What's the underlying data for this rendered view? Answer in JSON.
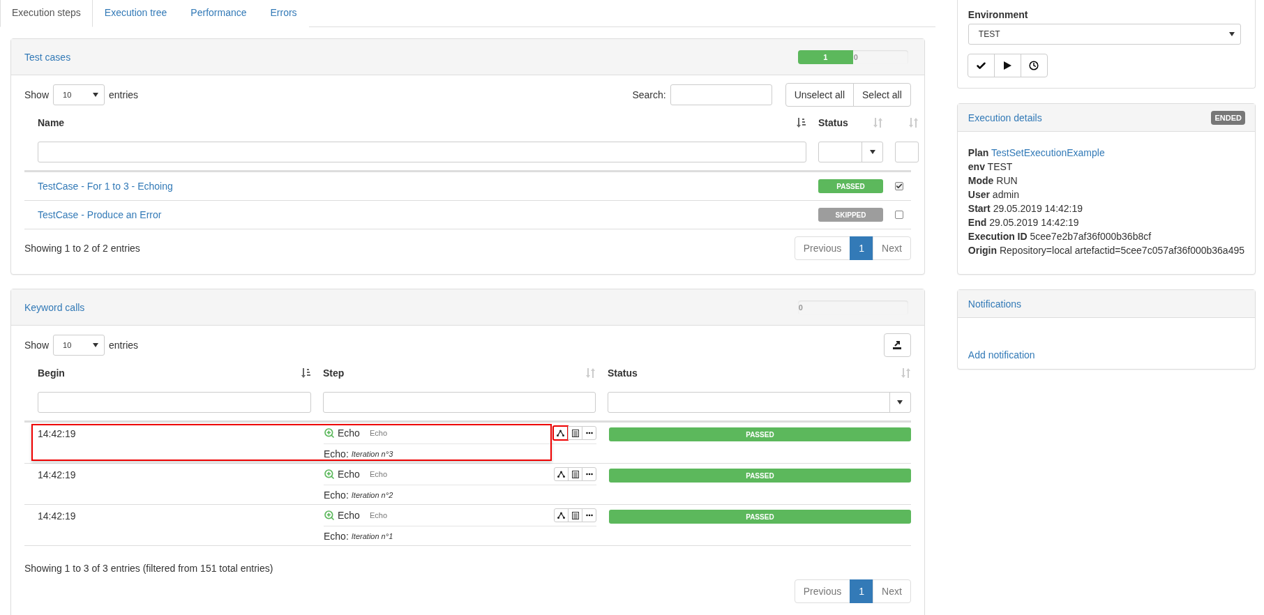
{
  "tabs": [
    {
      "label": "Execution steps",
      "selected": true
    },
    {
      "label": "Execution tree",
      "selected": false
    },
    {
      "label": "Performance",
      "selected": false
    },
    {
      "label": "Errors",
      "selected": false
    }
  ],
  "test_cases": {
    "title": "Test cases",
    "progress": {
      "level": 0.5,
      "fill_label": "1",
      "rest_label": "0"
    },
    "length": {
      "before": "Show",
      "value": "10",
      "after": "entries"
    },
    "search": {
      "label": "Search:"
    },
    "buttons": [
      "Unselect all",
      "Select all"
    ],
    "columns": [
      {
        "label": "Name",
        "sorted": true
      },
      {
        "label": "Status",
        "sorted": false
      },
      {
        "sorted": false
      }
    ],
    "rows": [
      {
        "name": "TestCase - For 1 to 3 - Echoing",
        "status": "PASSED",
        "kind": "passed",
        "checked": true
      },
      {
        "name": "TestCase - Produce an Error",
        "status": "SKIPPED",
        "kind": "skipped",
        "checked": false
      }
    ],
    "info": "Showing 1 to 2 of 2 entries",
    "pagination": {
      "previous": "Previous",
      "pages": [
        {
          "label": "1",
          "selected": true
        }
      ],
      "next": "Next"
    }
  },
  "keyword_calls": {
    "title": "Keyword calls",
    "progress": {
      "level": 0,
      "rest_label": "0"
    },
    "length": {
      "before": "Show",
      "value": "10",
      "after": "entries"
    },
    "columns": [
      {
        "label": "Begin",
        "sorted": true
      },
      {
        "label": "Step",
        "sorted": false
      },
      {
        "label": "Status",
        "sorted": false
      }
    ],
    "rows": [
      {
        "begin": "14:42:19",
        "step": "Echo",
        "step_type": "Echo",
        "detail_label": "Echo:",
        "detail_value": "Iteration n°3",
        "status": "PASSED",
        "kind": "passed",
        "highlighted": true,
        "tree_button_highlighted": true
      },
      {
        "begin": "14:42:19",
        "step": "Echo",
        "step_type": "Echo",
        "detail_label": "Echo:",
        "detail_value": "Iteration n°2",
        "status": "PASSED",
        "kind": "passed",
        "highlighted": false,
        "tree_button_highlighted": false
      },
      {
        "begin": "14:42:19",
        "step": "Echo",
        "step_type": "Echo",
        "detail_label": "Echo:",
        "detail_value": "Iteration n°1",
        "status": "PASSED",
        "kind": "passed",
        "highlighted": false,
        "tree_button_highlighted": false
      }
    ],
    "info": "Showing 1 to 3 of 3 entries (filtered from 151 total entries)",
    "pagination": {
      "previous": "Previous",
      "pages": [
        {
          "label": "1",
          "selected": true
        }
      ],
      "next": "Next"
    }
  },
  "environment": {
    "label": "Environment",
    "value": "TEST"
  },
  "execution_details": {
    "title": "Execution details",
    "status": "ENDED",
    "fields": [
      {
        "label": "Plan",
        "value": "TestSetExecutionExample",
        "kind": "link"
      },
      {
        "label": "env",
        "value": "TEST",
        "kind": "text"
      },
      {
        "label": "Mode",
        "value": "RUN",
        "kind": "text"
      },
      {
        "label": "User",
        "value": "admin",
        "kind": "text"
      },
      {
        "label": "Start",
        "value": "29.05.2019 14:42:19",
        "kind": "text"
      },
      {
        "label": "End",
        "value": "29.05.2019 14:42:19",
        "kind": "text"
      },
      {
        "label": "Execution ID",
        "value": "5cee7e2b7af36f000b36b8cf",
        "kind": "text"
      },
      {
        "label": "Origin",
        "value": "Repository=local artefactid=5cee7c057af36f000b36a495",
        "kind": "text"
      }
    ]
  },
  "notifications": {
    "title": "Notifications",
    "link": "Add notification"
  }
}
